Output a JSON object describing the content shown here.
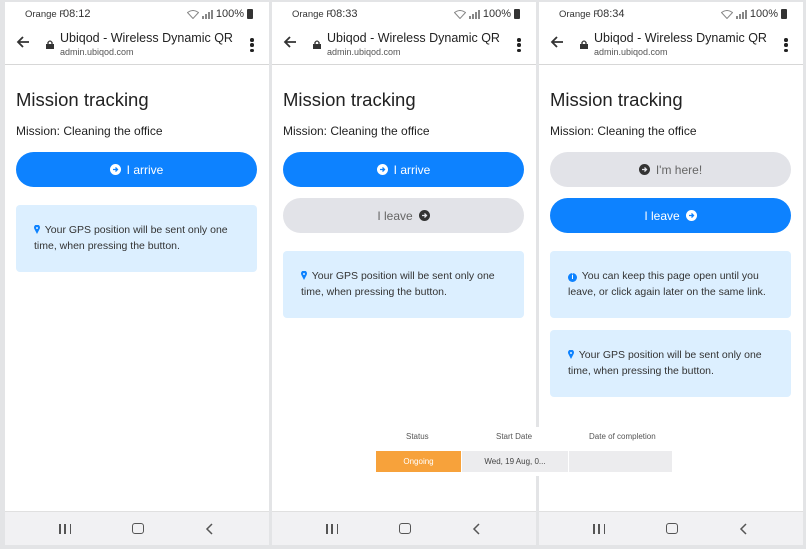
{
  "browser": {
    "title": "Ubiqod - Wireless Dynamic QR ...",
    "domain": "admin.ubiqod.com",
    "battery": "100%",
    "carrier": "Orange F"
  },
  "screens": [
    {
      "time": "08:12",
      "heading": "Mission tracking",
      "mission": "Mission: Cleaning the office",
      "arrive_button": "I arrive",
      "gps_notice": "Your GPS position will be sent only one time, when pressing the button."
    },
    {
      "time": "08:33",
      "heading": "Mission tracking",
      "mission": "Mission: Cleaning the office",
      "arrive_button": "I arrive",
      "leave_button": "I leave",
      "gps_notice": "Your GPS position will be sent only one time, when pressing the button."
    },
    {
      "time": "08:34",
      "heading": "Mission tracking",
      "mission": "Mission: Cleaning the office",
      "here_button": "I'm here!",
      "leave_button": "I leave",
      "keep_open_notice": "You can keep this page open until you leave, or click again later on the same link.",
      "gps_notice": "Your GPS position will be sent only one time, when pressing the button."
    }
  ],
  "table": {
    "headers": [
      "Status",
      "Start Date",
      "Date of completion"
    ],
    "row": {
      "status": "Ongoing",
      "start_date": "Wed, 19 Aug, 0...",
      "completion": ""
    }
  },
  "colors": {
    "primary": "#0d82ff",
    "disabled": "#e2e3e8",
    "info_bg": "#dcefff",
    "ongoing": "#f7a23b"
  }
}
